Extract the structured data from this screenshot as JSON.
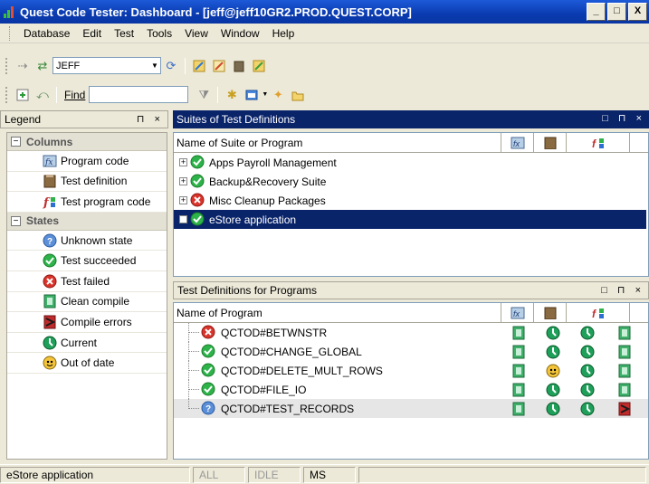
{
  "window": {
    "title": "Quest Code Tester: Dashboard - [jeff@jeff10GR2.PROD.QUEST.CORP]",
    "min": "_",
    "max": "□",
    "close": "X"
  },
  "menu": [
    "Database",
    "Edit",
    "Test",
    "Tools",
    "View",
    "Window",
    "Help"
  ],
  "toolbar": {
    "schema": "JEFF",
    "find_label": "Find",
    "find_value": ""
  },
  "legend": {
    "title": "Legend",
    "controls": "⊓ ×",
    "groups": [
      {
        "label": "Columns",
        "items": [
          {
            "icon": "program-code-icon",
            "label": "Program code"
          },
          {
            "icon": "test-definition-icon",
            "label": "Test definition"
          },
          {
            "icon": "test-program-code-icon",
            "label": "Test program code"
          }
        ]
      },
      {
        "label": "States",
        "items": [
          {
            "icon": "unknown-state-icon",
            "label": "Unknown state"
          },
          {
            "icon": "test-succeeded-icon",
            "label": "Test succeeded"
          },
          {
            "icon": "test-failed-icon",
            "label": "Test failed"
          },
          {
            "icon": "clean-compile-icon",
            "label": "Clean compile"
          },
          {
            "icon": "compile-errors-icon",
            "label": "Compile errors"
          },
          {
            "icon": "current-icon",
            "label": "Current"
          },
          {
            "icon": "out-of-date-icon",
            "label": "Out of date"
          }
        ]
      }
    ]
  },
  "suites": {
    "title": "Suites of Test Definitions",
    "column": "Name of Suite or Program",
    "rows": [
      {
        "name": "Apps Payroll Management",
        "state": "succeeded"
      },
      {
        "name": "Backup&Recovery Suite",
        "state": "succeeded"
      },
      {
        "name": "Misc Cleanup Packages",
        "state": "failed"
      },
      {
        "name": "eStore application",
        "state": "succeeded",
        "selected": true
      }
    ]
  },
  "programs": {
    "title": "Test Definitions for Programs",
    "column": "Name of Program",
    "rows": [
      {
        "name": "QCTOD#BETWNSTR",
        "state": "failed",
        "cells": [
          "clean",
          "current",
          "current",
          "clean"
        ]
      },
      {
        "name": "QCTOD#CHANGE_GLOBAL",
        "state": "succeeded",
        "cells": [
          "clean",
          "current",
          "current",
          "clean"
        ]
      },
      {
        "name": "QCTOD#DELETE_MULT_ROWS",
        "state": "succeeded",
        "cells": [
          "clean",
          "outofdate",
          "current",
          "clean"
        ]
      },
      {
        "name": "QCTOD#FILE_IO",
        "state": "succeeded",
        "cells": [
          "clean",
          "current",
          "current",
          "clean"
        ]
      },
      {
        "name": "QCTOD#TEST_RECORDS",
        "state": "unknown",
        "cells": [
          "clean",
          "current",
          "current",
          "errors"
        ],
        "highlight": true
      }
    ]
  },
  "status": {
    "context": "eStore application",
    "all": "ALL",
    "idle": "IDLE",
    "ms": "MS"
  },
  "colors": {
    "title_bar": "#0A3BB0",
    "selection": "#0A246A",
    "succeeded": "#2DB34A",
    "failed": "#D9342B",
    "unknown": "#5B8FD8"
  }
}
